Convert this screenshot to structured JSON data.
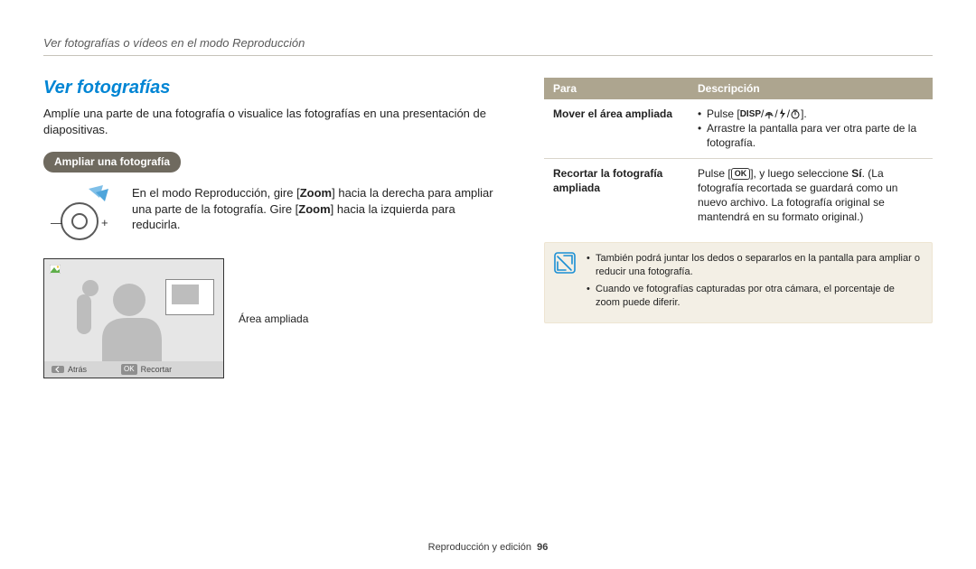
{
  "header": "Ver fotografías o vídeos en el modo Reproducción",
  "title": "Ver fotografías",
  "intro": "Amplíe una parte de una fotografía o visualice las fotografías en una presentación de diapositivas.",
  "section_pill": "Ampliar una fotografía",
  "zoom_instruction": {
    "pre": "En el modo Reproducción, gire [",
    "b1": "Zoom",
    "mid": "] hacia la derecha para ampliar una parte de la fotografía. Gire [",
    "b2": "Zoom",
    "post": "] hacia la izquierda para reducirla."
  },
  "preview": {
    "caption": "Área ampliada",
    "back_btn": "Atrás",
    "ok_btn": "OK",
    "crop_btn": "Recortar"
  },
  "table": {
    "head_a": "Para",
    "head_b": "Descripción",
    "row1_label": "Mover el área ampliada",
    "row1_b1": "Pulse [",
    "row1_b2": "].",
    "row1_c": "Arrastre la pantalla para ver otra parte de la fotografía.",
    "row2_label": "Recortar la fotografía ampliada",
    "row2_pre": "Pulse [",
    "row2_mid": "], y luego seleccione ",
    "row2_si": "Sí",
    "row2_post": ". (La fotografía recortada se guardará como un nuevo archivo. La fotografía original se mantendrá en su formato original.)"
  },
  "notes": {
    "n1": "También podrá juntar los dedos o separarlos en la pantalla para ampliar o reducir una fotografía.",
    "n2": "Cuando ve fotografías capturadas por otra cámara, el porcentaje de zoom puede diferir."
  },
  "footer": {
    "section": "Reproducción y edición",
    "page": "96"
  },
  "icons": {
    "disp": "DISP"
  }
}
